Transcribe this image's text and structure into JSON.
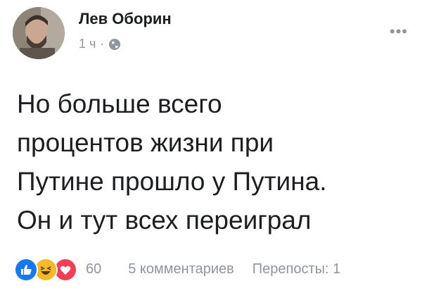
{
  "post": {
    "author": "Лев Оборин",
    "time": "1 ч",
    "separator": "·",
    "privacy_icon": "globe-icon",
    "menu_icon": "more-options-icon",
    "more_label": "•••",
    "lines": [
      "Но больше всего",
      "процентов жизни при",
      "Путине прошло у Путина.",
      "Он и тут всех переиграл"
    ]
  },
  "footer": {
    "reactions": [
      "like-icon",
      "haha-icon",
      "love-icon"
    ],
    "reaction_count": "60",
    "comments": "5 комментариев",
    "shares": "Перепосты: 1"
  },
  "colors": {
    "text": "#1c1e21",
    "secondary": "#90949c",
    "like": "#1877f2",
    "haha": "#f7b928",
    "love": "#f33e58"
  }
}
